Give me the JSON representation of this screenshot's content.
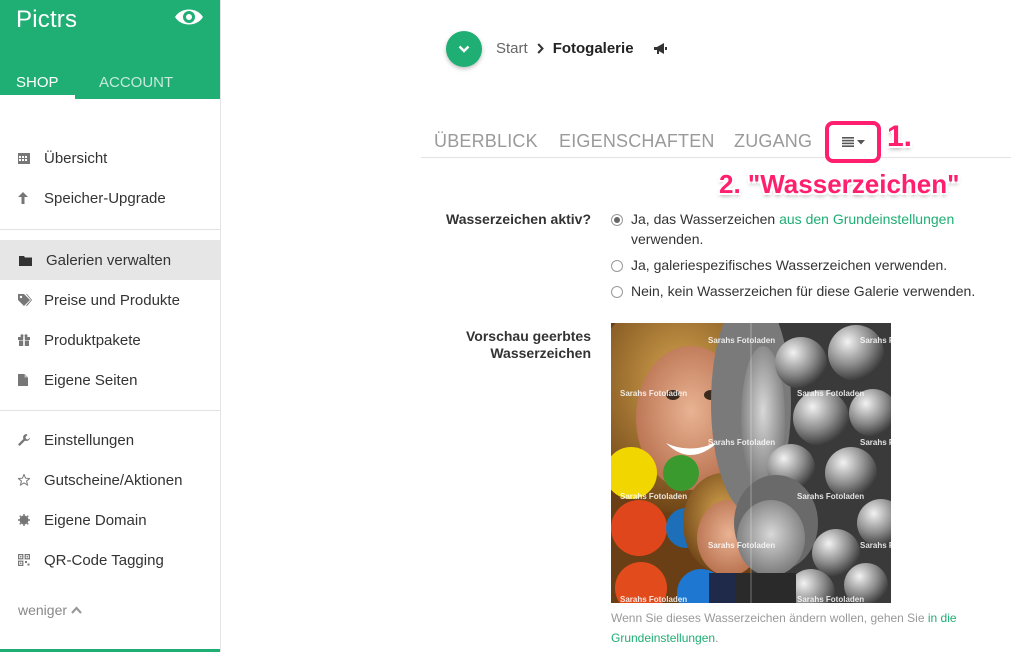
{
  "app": {
    "name": "Pictrs"
  },
  "sidebar": {
    "tabs": [
      {
        "label": "SHOP"
      },
      {
        "label": "ACCOUNT"
      }
    ],
    "items": [
      {
        "label": "Übersicht",
        "icon": "calendar-icon"
      },
      {
        "label": "Speicher-Upgrade",
        "icon": "arrow-up-icon"
      },
      {
        "label": "Galerien verwalten",
        "icon": "folder-icon"
      },
      {
        "label": "Preise und Produkte",
        "icon": "tags-icon"
      },
      {
        "label": "Produktpakete",
        "icon": "gift-icon"
      },
      {
        "label": "Eigene Seiten",
        "icon": "file-icon"
      },
      {
        "label": "Einstellungen",
        "icon": "wrench-icon"
      },
      {
        "label": "Gutscheine/Aktionen",
        "icon": "star-icon"
      },
      {
        "label": "Eigene Domain",
        "icon": "certificate-icon"
      },
      {
        "label": "QR-Code Tagging",
        "icon": "qrcode-icon"
      }
    ],
    "less_label": "weniger"
  },
  "breadcrumb": {
    "start": "Start",
    "current": "Fotogalerie"
  },
  "tabs": [
    {
      "label": "ÜBERBLICK"
    },
    {
      "label": "EIGENSCHAFTEN"
    },
    {
      "label": "ZUGANG"
    }
  ],
  "annotations": {
    "step1": "1.",
    "step2": "2. \"Wasserzeichen\""
  },
  "watermark_form": {
    "active_label": "Wasserzeichen aktiv?",
    "options": [
      {
        "text_before": "Ja, das Wasserzeichen ",
        "link": "aus den Grundeinstellungen",
        "text_after": "verwenden.",
        "checked": true
      },
      {
        "text": "Ja, galeriespezifisches Wasserzeichen verwenden.",
        "checked": false
      },
      {
        "text": "Nein, kein Wasserzeichen für diese Galerie verwenden.",
        "checked": false
      }
    ],
    "preview_label_line1": "Vorschau geerbtes",
    "preview_label_line2": "Wasserzeichen",
    "watermark_text": "Sarahs Fotoladen",
    "hint_before": "Wenn Sie dieses Wasserzeichen ändern wollen, gehen Sie ",
    "hint_link_1": "in die",
    "hint_link_2": "Grundeinstellungen",
    "hint_after": "."
  },
  "colors": {
    "brand": "#1fae74",
    "annotation": "#ff1f6e",
    "active_item_bg": "#e6e6e6"
  }
}
